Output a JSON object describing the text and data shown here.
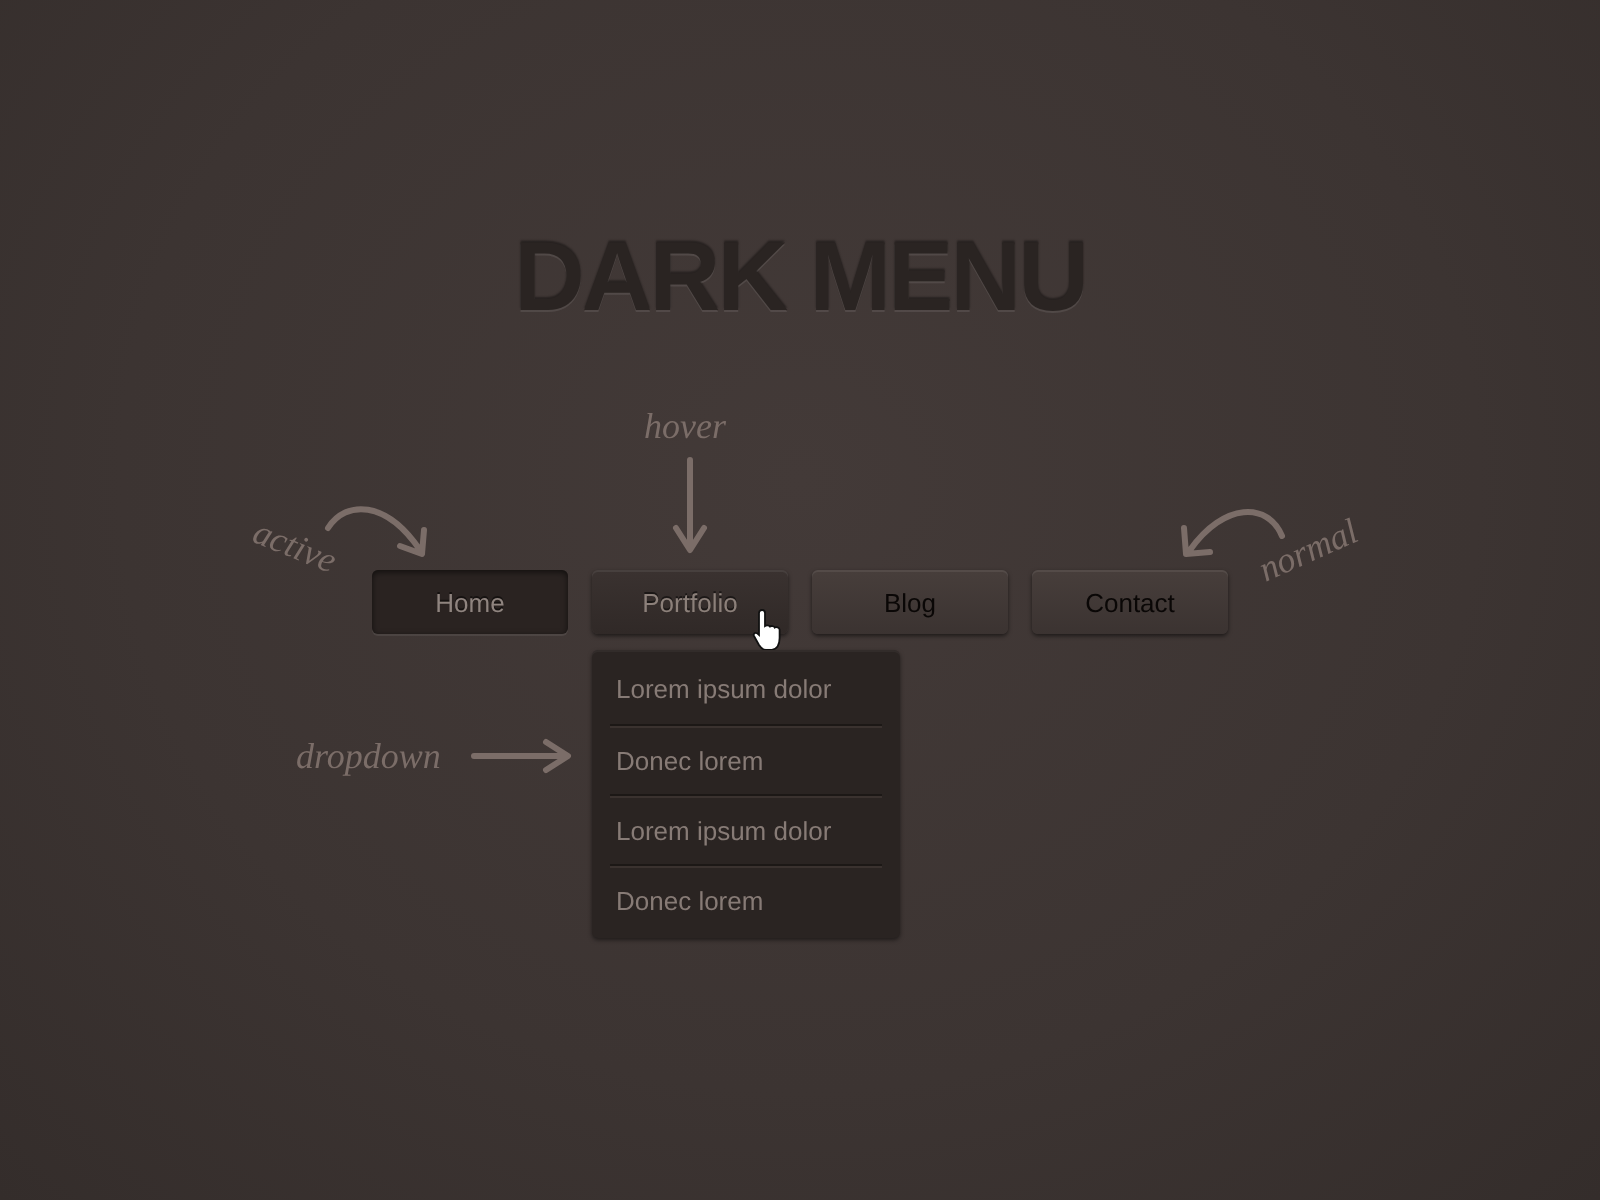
{
  "title": "DARK MENU",
  "menu": [
    {
      "label": "Home",
      "selected": true,
      "hovered": false
    },
    {
      "label": "Portfolio",
      "selected": false,
      "hovered": true,
      "dropdown": [
        "Lorem ipsum dolor",
        "Donec lorem",
        "Lorem ipsum dolor",
        "Donec lorem"
      ]
    },
    {
      "label": "Blog",
      "selected": false,
      "hovered": false
    },
    {
      "label": "Contact",
      "selected": false,
      "hovered": false
    }
  ],
  "annotations": [
    {
      "text": "active"
    },
    {
      "text": "hover"
    },
    {
      "text": "normal"
    },
    {
      "text": "dropdown"
    }
  ]
}
